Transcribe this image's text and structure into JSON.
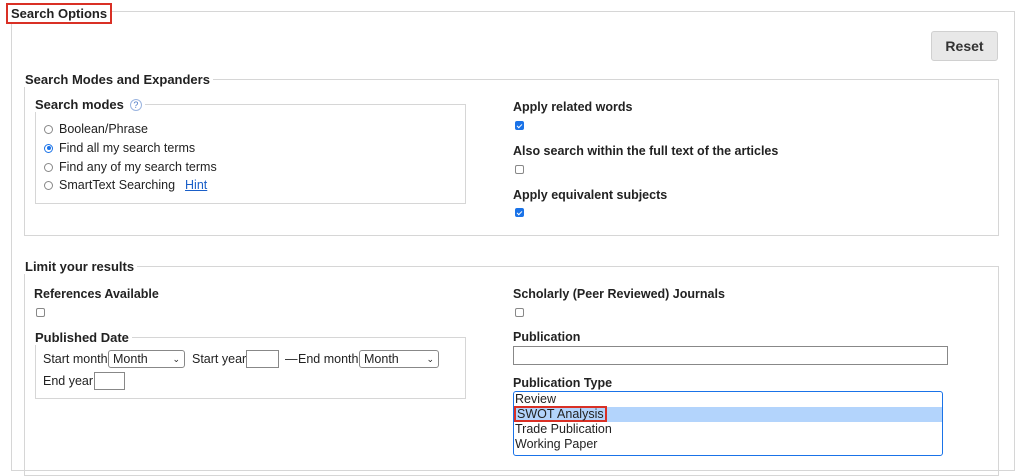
{
  "search_options": {
    "title": "Search Options",
    "reset_label": "Reset"
  },
  "modes_expanders": {
    "legend": "Search Modes and Expanders",
    "search_modes": {
      "legend": "Search modes",
      "help_icon": "question-icon",
      "options": [
        {
          "label": "Boolean/Phrase",
          "selected": false
        },
        {
          "label": "Find all my search terms",
          "selected": true
        },
        {
          "label": "Find any of my search terms",
          "selected": false
        },
        {
          "label": "SmartText Searching",
          "selected": false
        }
      ],
      "hint_label": "Hint"
    },
    "related_words": {
      "label": "Apply related words",
      "checked": true
    },
    "full_text": {
      "label": "Also search within the full text of the articles",
      "checked": false
    },
    "equivalent_subjects": {
      "label": "Apply equivalent subjects",
      "checked": true
    }
  },
  "limits": {
    "legend": "Limit your results",
    "references": {
      "label": "References Available",
      "checked": false
    },
    "scholarly": {
      "label": "Scholarly (Peer Reviewed) Journals",
      "checked": false
    },
    "published_date": {
      "legend": "Published Date",
      "start_month_label": "Start month:",
      "start_month_value": "Month",
      "start_year_label": "Start year:",
      "start_year_value": "",
      "separator": "—",
      "end_month_label": "End month:",
      "end_month_value": "Month",
      "end_year_label": "End year:",
      "end_year_value": ""
    },
    "publication": {
      "label": "Publication",
      "value": ""
    },
    "publication_type": {
      "label": "Publication Type",
      "options": [
        "Review",
        "SWOT Analysis",
        "Trade Publication",
        "Working Paper"
      ],
      "selected": "SWOT Analysis"
    }
  },
  "colors": {
    "accent": "#1a73e8",
    "highlight": "#b3d4fc",
    "red_outline": "#d93025",
    "reset_bg": "#e8e8e8"
  }
}
